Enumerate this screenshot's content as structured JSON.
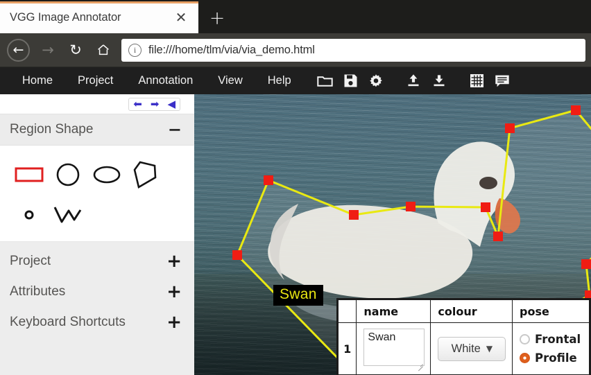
{
  "browser": {
    "tab": {
      "title": "VGG Image Annotator",
      "close_icon": "close-icon"
    },
    "new_tab_icon": "plus-icon",
    "nav": {
      "back_icon": "arrow-left-icon",
      "forward_icon": "arrow-right-icon",
      "reload_icon": "reload-icon",
      "home_icon": "home-icon"
    },
    "address": {
      "info_icon": "info-icon",
      "url": "file:///home/tlm/via/via_demo.html"
    }
  },
  "via_menu": {
    "items": [
      {
        "label": "Home"
      },
      {
        "label": "Project"
      },
      {
        "label": "Annotation"
      },
      {
        "label": "View"
      },
      {
        "label": "Help"
      }
    ],
    "tools": [
      {
        "icon": "folder-open-icon",
        "title": "Open"
      },
      {
        "icon": "floppy-save-icon",
        "title": "Save"
      },
      {
        "icon": "gear-settings-icon",
        "title": "Settings"
      },
      {
        "icon": "upload-icon",
        "title": "Import"
      },
      {
        "icon": "download-icon",
        "title": "Export"
      },
      {
        "icon": "grid-icon",
        "title": "Image Grid"
      },
      {
        "icon": "comment-list-icon",
        "title": "Annotation Editor"
      }
    ]
  },
  "sidebar": {
    "nav_arrows": [
      {
        "icon": "arrow-left-icon"
      },
      {
        "icon": "arrow-right-icon"
      },
      {
        "icon": "play-back-triangle-icon"
      }
    ],
    "region_shape": {
      "title": "Region Shape",
      "toggle_sign": "−",
      "shapes": [
        {
          "name": "rect-shape-icon",
          "selected": true
        },
        {
          "name": "circle-shape-icon",
          "selected": false
        },
        {
          "name": "ellipse-shape-icon",
          "selected": false
        },
        {
          "name": "polygon-shape-icon",
          "selected": false
        },
        {
          "name": "point-shape-icon",
          "selected": false
        },
        {
          "name": "polyline-shape-icon",
          "selected": false
        }
      ]
    },
    "sections": [
      {
        "title": "Project",
        "toggle_sign": "+"
      },
      {
        "title": "Attributes",
        "toggle_sign": "+"
      },
      {
        "title": "Keyboard Shortcuts",
        "toggle_sign": "+"
      }
    ]
  },
  "canvas": {
    "region_label": "Swan",
    "region_label_color": "#e9e612",
    "polygon_stroke": "#e9e912",
    "vertex_color": "#f01d14"
  },
  "annotation_table": {
    "columns": [
      "",
      "name",
      "colour",
      "pose"
    ],
    "rows": [
      {
        "index": "1",
        "name": "Swan",
        "name_placeholder": "name",
        "colour": "White",
        "colour_chevron": "⌄",
        "pose": [
          {
            "label": "Frontal",
            "selected": false
          },
          {
            "label": "Profile",
            "selected": true
          }
        ]
      }
    ]
  },
  "colors": {
    "tab_accent": "#e8a064",
    "chrome_bg": "#3c3b37",
    "menubar_bg": "#1f1f1f",
    "selected_shape": "#e02020",
    "radio_selected": "#e0601d"
  }
}
